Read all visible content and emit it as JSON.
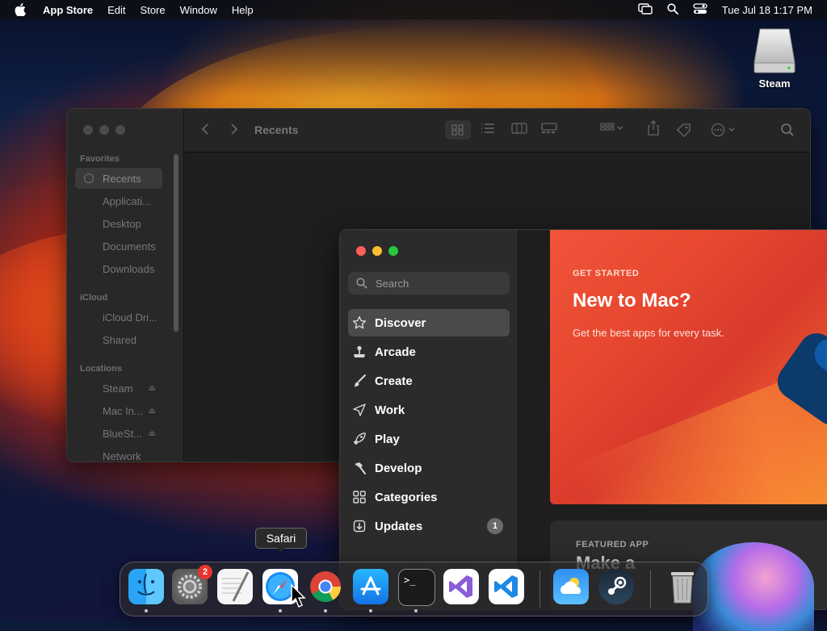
{
  "menubar": {
    "app_name": "App Store",
    "menus": [
      "Edit",
      "Store",
      "Window",
      "Help"
    ],
    "clock": "Tue Jul 18  1:17 PM"
  },
  "desktop": {
    "drive_label": "Steam"
  },
  "finder": {
    "title": "Recents",
    "favorites_header": "Favorites",
    "favorites": [
      "Recents",
      "Applicati...",
      "Desktop",
      "Documents",
      "Downloads"
    ],
    "icloud_header": "iCloud",
    "icloud": [
      "iCloud Dri...",
      "Shared"
    ],
    "locations_header": "Locations",
    "locations": [
      "Steam",
      "Mac In...",
      "BlueSt...",
      "Network"
    ]
  },
  "appstore": {
    "search_placeholder": "Search",
    "nav": [
      {
        "label": "Discover",
        "icon": "star-icon"
      },
      {
        "label": "Arcade",
        "icon": "joystick-icon"
      },
      {
        "label": "Create",
        "icon": "paintbrush-icon"
      },
      {
        "label": "Work",
        "icon": "paperplane-icon"
      },
      {
        "label": "Play",
        "icon": "rocket-icon"
      },
      {
        "label": "Develop",
        "icon": "hammer-icon"
      },
      {
        "label": "Categories",
        "icon": "grid-icon"
      },
      {
        "label": "Updates",
        "icon": "download-icon",
        "badge": "1"
      }
    ],
    "hero": {
      "kicker": "GET STARTED",
      "headline": "New to Mac?",
      "subtitle": "Get the best apps for every task."
    },
    "featured": {
      "kicker": "FEATURED APP",
      "title": "Make a"
    }
  },
  "dock": {
    "tooltip": "Safari",
    "apps": [
      "Finder",
      "System Settings",
      "TextEdit",
      "Safari",
      "Google Chrome",
      "App Store",
      "Terminal",
      "Visual Studio",
      "Visual Studio Code",
      "Weather",
      "Steam",
      "Trash"
    ],
    "settings_badge": "2"
  },
  "colors": {
    "close": "#ff5f57",
    "minimize": "#febc2e",
    "zoom": "#28c840",
    "hero_red": "#e7482f",
    "badge_red": "#e8342e"
  }
}
